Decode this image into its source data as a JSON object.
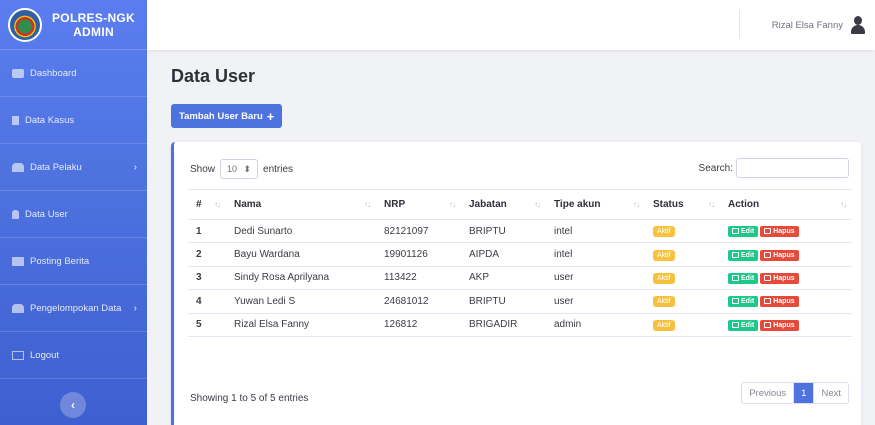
{
  "brand": {
    "line1": "POLRES-NGK",
    "line2": "ADMIN"
  },
  "sidebar": {
    "items": [
      {
        "label": "Dashboard",
        "icon": "dashboard-icon"
      },
      {
        "label": "Data Kasus",
        "icon": "file-icon"
      },
      {
        "label": "Data Pelaku",
        "icon": "users-icon",
        "chevron": "›"
      },
      {
        "label": "Data User",
        "icon": "user-icon"
      },
      {
        "label": "Posting Berita",
        "icon": "news-icon"
      },
      {
        "label": "Pengelompokan Data",
        "icon": "users-icon",
        "chevron": "›"
      },
      {
        "label": "Logout",
        "icon": "logout-icon"
      }
    ],
    "toggle": "‹"
  },
  "topbar": {
    "user_name": "Rizal Elsa Fanny"
  },
  "page": {
    "title": "Data User",
    "add_button": "Tambah User Baru",
    "add_icon": "+"
  },
  "table_controls": {
    "show": "Show",
    "length": "10",
    "entries": "entries",
    "search_label": "Search:"
  },
  "table": {
    "headers": [
      "#",
      "Nama",
      "NRP",
      "Jabatan",
      "Tipe akun",
      "Status",
      "Action"
    ],
    "rows": [
      {
        "no": "1",
        "nama": "Dedi Sunarto",
        "nrp": "82121097",
        "jabatan": "BRIPTU",
        "tipe": "intel",
        "status": "Aktif"
      },
      {
        "no": "2",
        "nama": "Bayu Wardana",
        "nrp": "19901126",
        "jabatan": "AIPDA",
        "tipe": "intel",
        "status": "Aktif"
      },
      {
        "no": "3",
        "nama": "Sindy Rosa Aprilyana",
        "nrp": "113422",
        "jabatan": "AKP",
        "tipe": "user",
        "status": "Aktif"
      },
      {
        "no": "4",
        "nama": "Yuwan Ledi S",
        "nrp": "24681012",
        "jabatan": "BRIPTU",
        "tipe": "user",
        "status": "Aktif"
      },
      {
        "no": "5",
        "nama": "Rizal Elsa Fanny",
        "nrp": "126812",
        "jabatan": "BRIGADIR",
        "tipe": "admin",
        "status": "Aktif"
      }
    ],
    "edit_label": "Edit",
    "delete_label": "Hapus"
  },
  "footer": {
    "info": "Showing 1 to 5 of 5 entries",
    "prev": "Previous",
    "page": "1",
    "next": "Next"
  },
  "colors": {
    "primary": "#4e73df",
    "warning": "#f6c23e",
    "success": "#1cc88a",
    "danger": "#e74a3b"
  }
}
